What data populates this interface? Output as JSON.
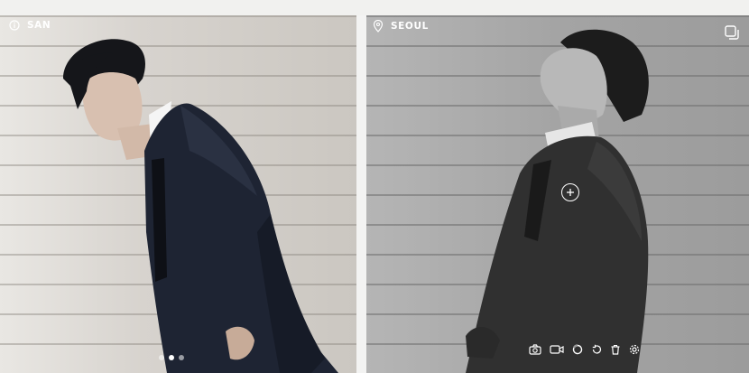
{
  "left_panel": {
    "title": "SAN",
    "icon": "info-icon",
    "carousel": {
      "count": 3,
      "active_index": 1
    }
  },
  "right_panel": {
    "title": "SEOUL",
    "icons": [
      "location-pin-icon",
      "copy-icon",
      "plus-icon"
    ],
    "toolbar": [
      "camera-icon",
      "video-icon",
      "loop-icon",
      "redo-icon",
      "trash-icon",
      "settings-icon"
    ]
  },
  "colors": {
    "left_wall": "#d9d6d2",
    "right_wall": "#9a9a9a",
    "suit": "#1e2433",
    "overlay_text": "#ffffff"
  }
}
